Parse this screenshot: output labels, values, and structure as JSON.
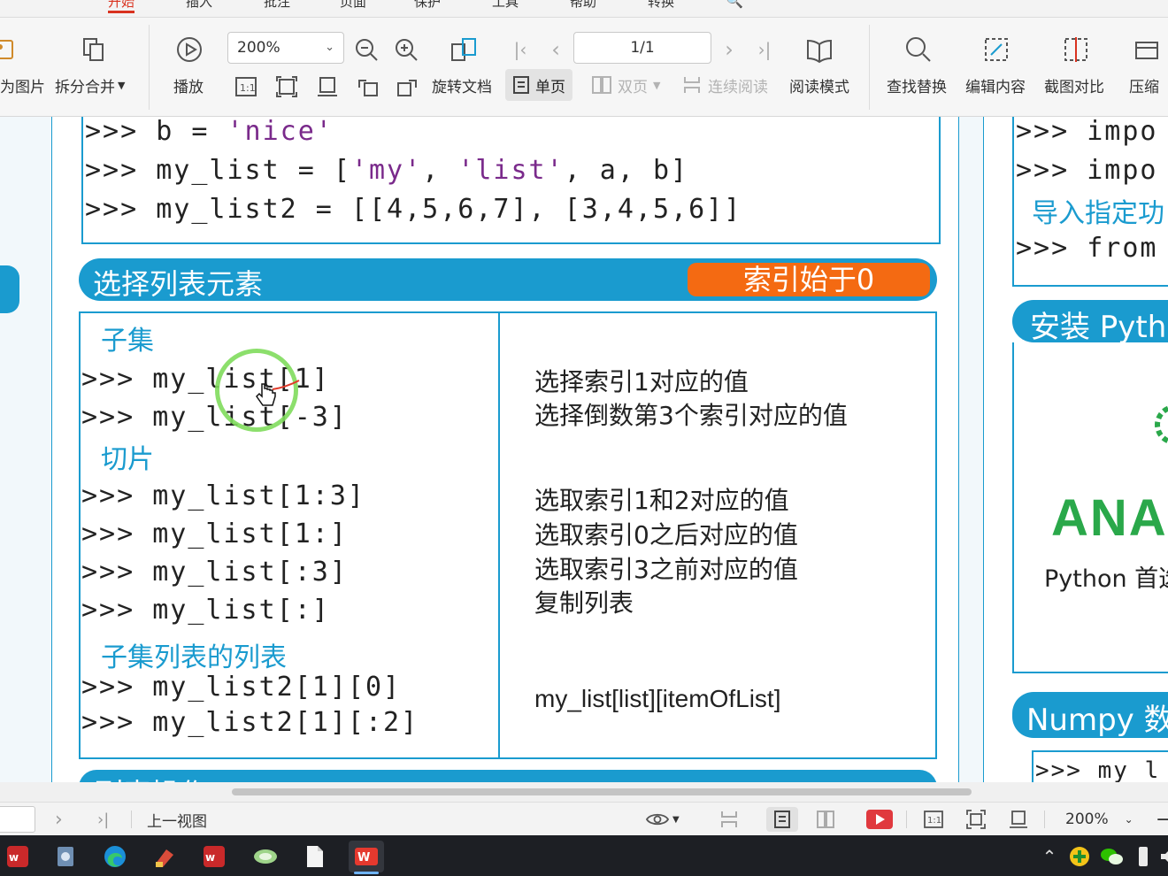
{
  "menu": {
    "items": [
      "开始",
      "插入",
      "批注",
      "页面",
      "保护",
      "工具",
      "帮助",
      "转换"
    ]
  },
  "toolbar": {
    "to_image_label": "为图片",
    "split_merge_label": "拆分合并",
    "play_label": "播放",
    "zoom_value": "200%",
    "rotate_label": "旋转文档",
    "page_value": "1/1",
    "single_page_label": "单页",
    "double_page_label": "双页",
    "continuous_label": "连续阅读",
    "reading_mode_label": "阅读模式",
    "find_replace_label": "查找替换",
    "edit_content_label": "编辑内容",
    "screenshot_compare_label": "截图对比",
    "compress_label": "压缩"
  },
  "document": {
    "top_code": [
      {
        "prefix": ">>> b = ",
        "str": "'nice'",
        "suffix": ""
      },
      {
        "prefix": ">>> my_list = [",
        "str": "'my'",
        "mid": ", ",
        "str2": "'list'",
        "suffix": ", a, b]"
      },
      {
        "prefix": ">>> my_list2 = [[4,5,6,7], [3,4,5,6]]",
        "str": "",
        "suffix": ""
      }
    ],
    "section_title": "选择列表元素",
    "section_badge": "索引始于0",
    "subset_heading": "子集",
    "subset_lines": [
      ">>> my_list[1]",
      ">>> my_list[-3]"
    ],
    "subset_desc": [
      "选择索引1对应的值",
      "选择倒数第3个索引对应的值"
    ],
    "slice_heading": "切片",
    "slice_lines": [
      ">>> my_list[1:3]",
      ">>> my_list[1:]",
      ">>> my_list[:3]",
      ">>> my_list[:]"
    ],
    "slice_desc": [
      "选取索引1和2对应的值",
      "选取索引0之后对应的值",
      "选取索引3之前对应的值",
      "复制列表"
    ],
    "nested_heading": "子集列表的列表",
    "nested_lines": [
      ">>> my_list2[1][0]",
      ">>> my_list2[1][:2]"
    ],
    "nested_desc": "my_list[list][itemOfList]",
    "next_section_partial": "列表操作"
  },
  "right_panel": {
    "code_lines": [
      ">>> impo",
      ">>> impo"
    ],
    "import_note": "导入指定功",
    "from_line": ">>> from",
    "install_title": "安装 Pyth",
    "anaconda_text": "ANAC",
    "python_first": "Python 首选",
    "numpy_title": "Numpy 数",
    "numpy_code": ">>> my l"
  },
  "statusbar": {
    "prev_view_label": "上一视图",
    "zoom_value": "200%"
  },
  "colors": {
    "accent_blue": "#1a9bcf",
    "badge_orange": "#f46a12",
    "string_purple": "#7a2a8b",
    "anaconda_green": "#2aa84a",
    "wps_red": "#d9321f"
  }
}
